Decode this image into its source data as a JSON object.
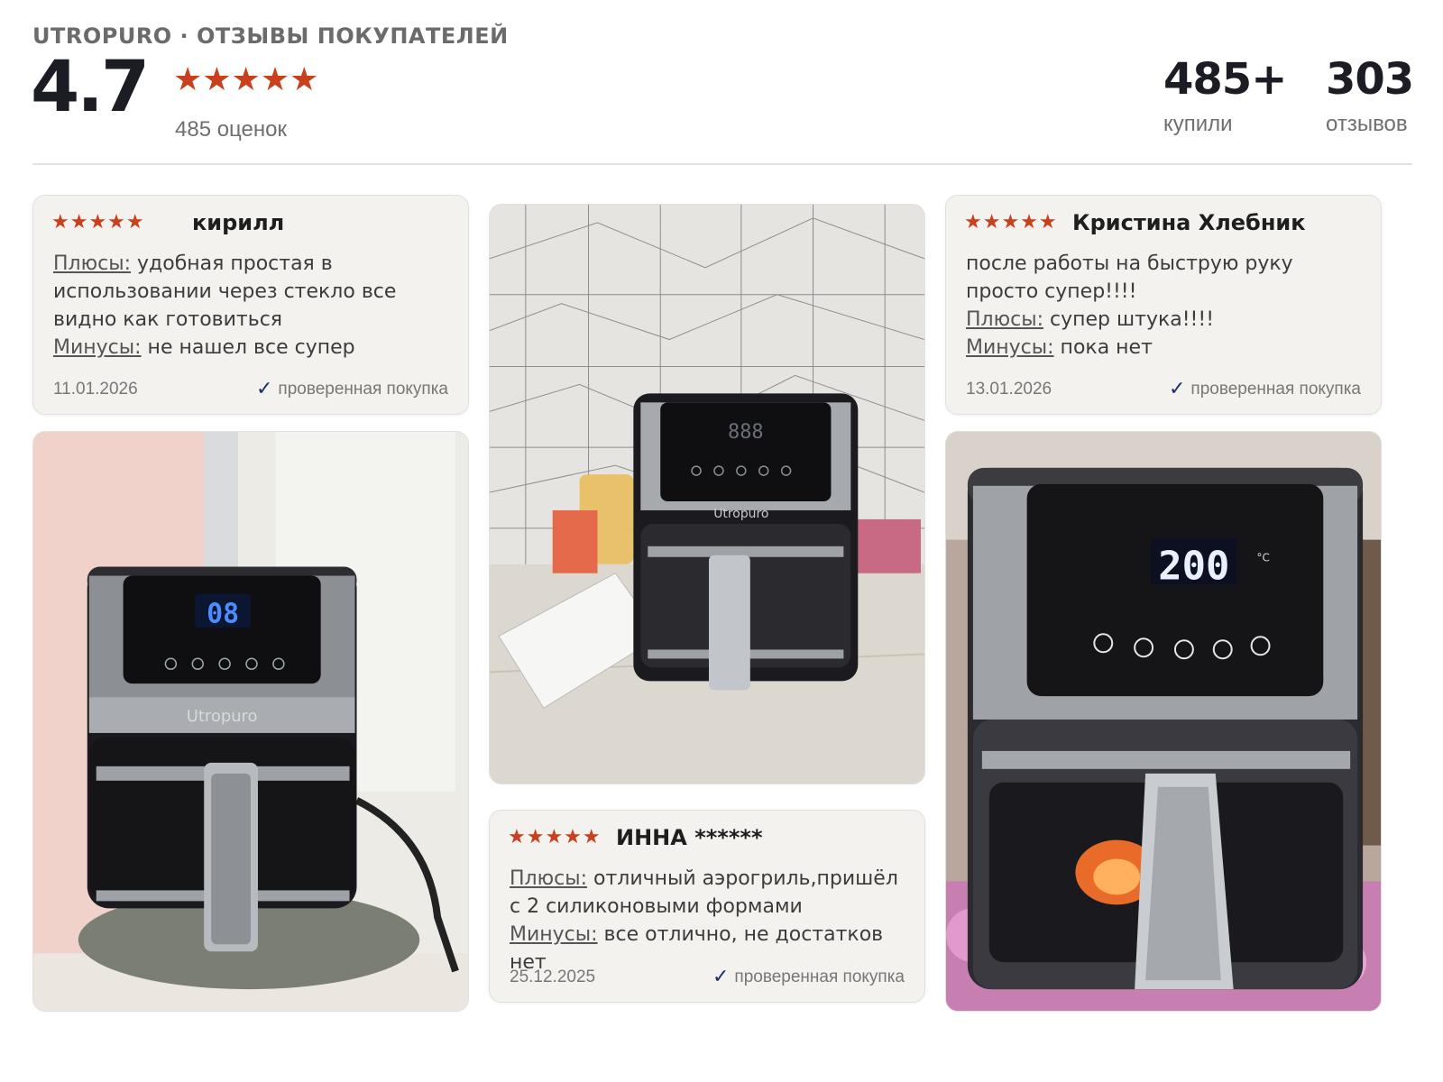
{
  "header": {
    "brand": "UTROPURO · ОТЗЫВЫ ПОКУПАТЕЛЕЙ",
    "rating": "4.7",
    "stars": "★★★★★",
    "ratings_count": "485 оценок",
    "bought_value": "485+",
    "bought_label": "купили",
    "reviews_value": "303",
    "reviews_label": "отзывов"
  },
  "colors": {
    "star": "#c8401c",
    "verified_check": "#1f2e6b"
  },
  "reviews": [
    {
      "stars": "★★★★★",
      "author": "кирилл",
      "pros_label": "Плюсы:",
      "pros": " удобная простая в использовании через стекло все видно как готовиться",
      "cons_label": "Минусы:",
      "cons": " не нашел все супер",
      "date": "11.01.2026",
      "verified": "проверенная покупка"
    },
    {
      "stars": "★★★★★",
      "author": "Кристина Хлебник",
      "intro": "после работы на быструю руку просто супер!!!!",
      "pros_label": "Плюсы:",
      "pros": " супер штука!!!!",
      "cons_label": "Минусы:",
      "cons": " пока нет",
      "date": "13.01.2026",
      "verified": "проверенная покупка"
    },
    {
      "stars": "★★★★★",
      "author": "ИННА ******",
      "pros_label": "Плюсы:",
      "pros": " отличный аэрогриль,пришёл с 2 силиконовыми формами",
      "cons_label": "Минусы:",
      "cons": " все отлично, не достатков нет",
      "date": "25.12.2025",
      "verified": "проверенная покупка"
    }
  ],
  "photos": {
    "photo1_display": "08",
    "photo1_brand": "Utropuro",
    "photo2_display": "888",
    "photo2_brand": "Utropuro",
    "photo3_display": "200",
    "photo3_unit": "°C"
  }
}
